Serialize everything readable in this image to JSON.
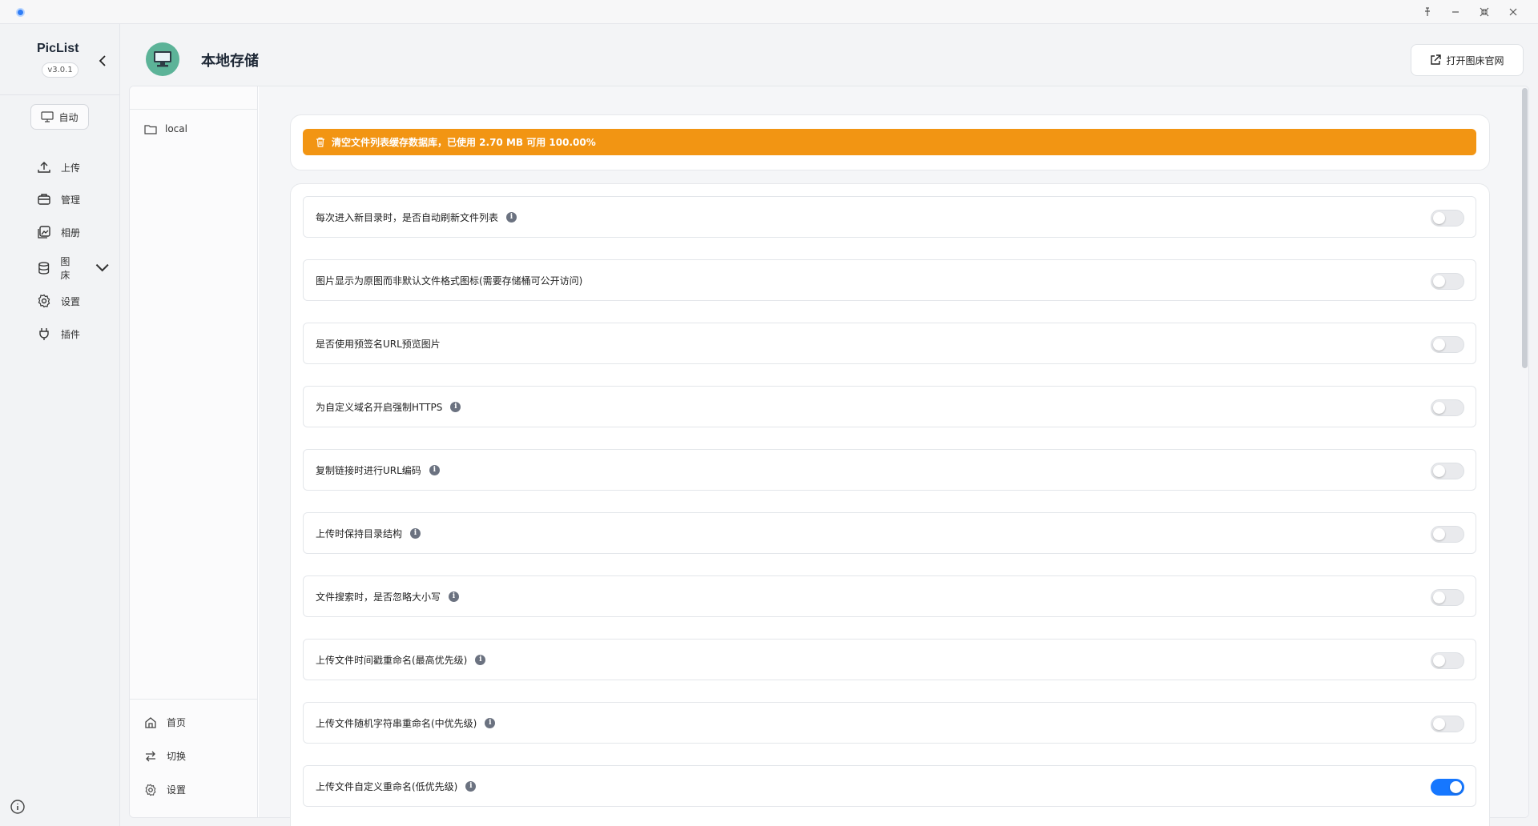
{
  "app": {
    "name": "PicList",
    "version": "v3.0.1"
  },
  "window_controls": [
    "pin-icon",
    "minimize-icon",
    "restore-icon",
    "close-icon"
  ],
  "sidebar": {
    "theme_button": "自动",
    "items": [
      {
        "label": "上传",
        "icon": "upload-icon"
      },
      {
        "label": "管理",
        "icon": "briefcase-icon"
      },
      {
        "label": "相册",
        "icon": "gallery-icon"
      },
      {
        "label": "图床",
        "icon": "database-icon"
      },
      {
        "label": "设置",
        "icon": "gear-icon"
      },
      {
        "label": "插件",
        "icon": "plug-icon"
      }
    ]
  },
  "header": {
    "title": "本地存储",
    "open_site_button": "打开图床官网"
  },
  "directory": {
    "items": [
      {
        "label": "local"
      }
    ],
    "actions": [
      {
        "label": "首页",
        "icon": "home-icon"
      },
      {
        "label": "切换",
        "icon": "switch-icon"
      },
      {
        "label": "设置",
        "icon": "gear-icon"
      }
    ]
  },
  "cache_notice": "清空文件列表缓存数据库，已使用 2.70 MB 可用 100.00%",
  "settings": [
    {
      "label": "每次进入新目录时，是否自动刷新文件列表",
      "info": true,
      "enabled": false
    },
    {
      "label": "图片显示为原图而非默认文件格式图标(需要存储桶可公开访问)",
      "info": false,
      "enabled": false
    },
    {
      "label": "是否使用预签名URL预览图片",
      "info": false,
      "enabled": false
    },
    {
      "label": "为自定义域名开启强制HTTPS",
      "info": true,
      "enabled": false
    },
    {
      "label": "复制链接时进行URL编码",
      "info": true,
      "enabled": false
    },
    {
      "label": "上传时保持目录结构",
      "info": true,
      "enabled": false
    },
    {
      "label": "文件搜索时，是否忽略大小写",
      "info": true,
      "enabled": false
    },
    {
      "label": "上传文件时间戳重命名(最高优先级)",
      "info": true,
      "enabled": false
    },
    {
      "label": "上传文件随机字符串重命名(中优先级)",
      "info": true,
      "enabled": false
    },
    {
      "label": "上传文件自定义重命名(低优先级)",
      "info": true,
      "enabled": true
    }
  ],
  "colors": {
    "accent": "#1677ff",
    "warning": "#f29513",
    "avatar": "#5cb398"
  }
}
